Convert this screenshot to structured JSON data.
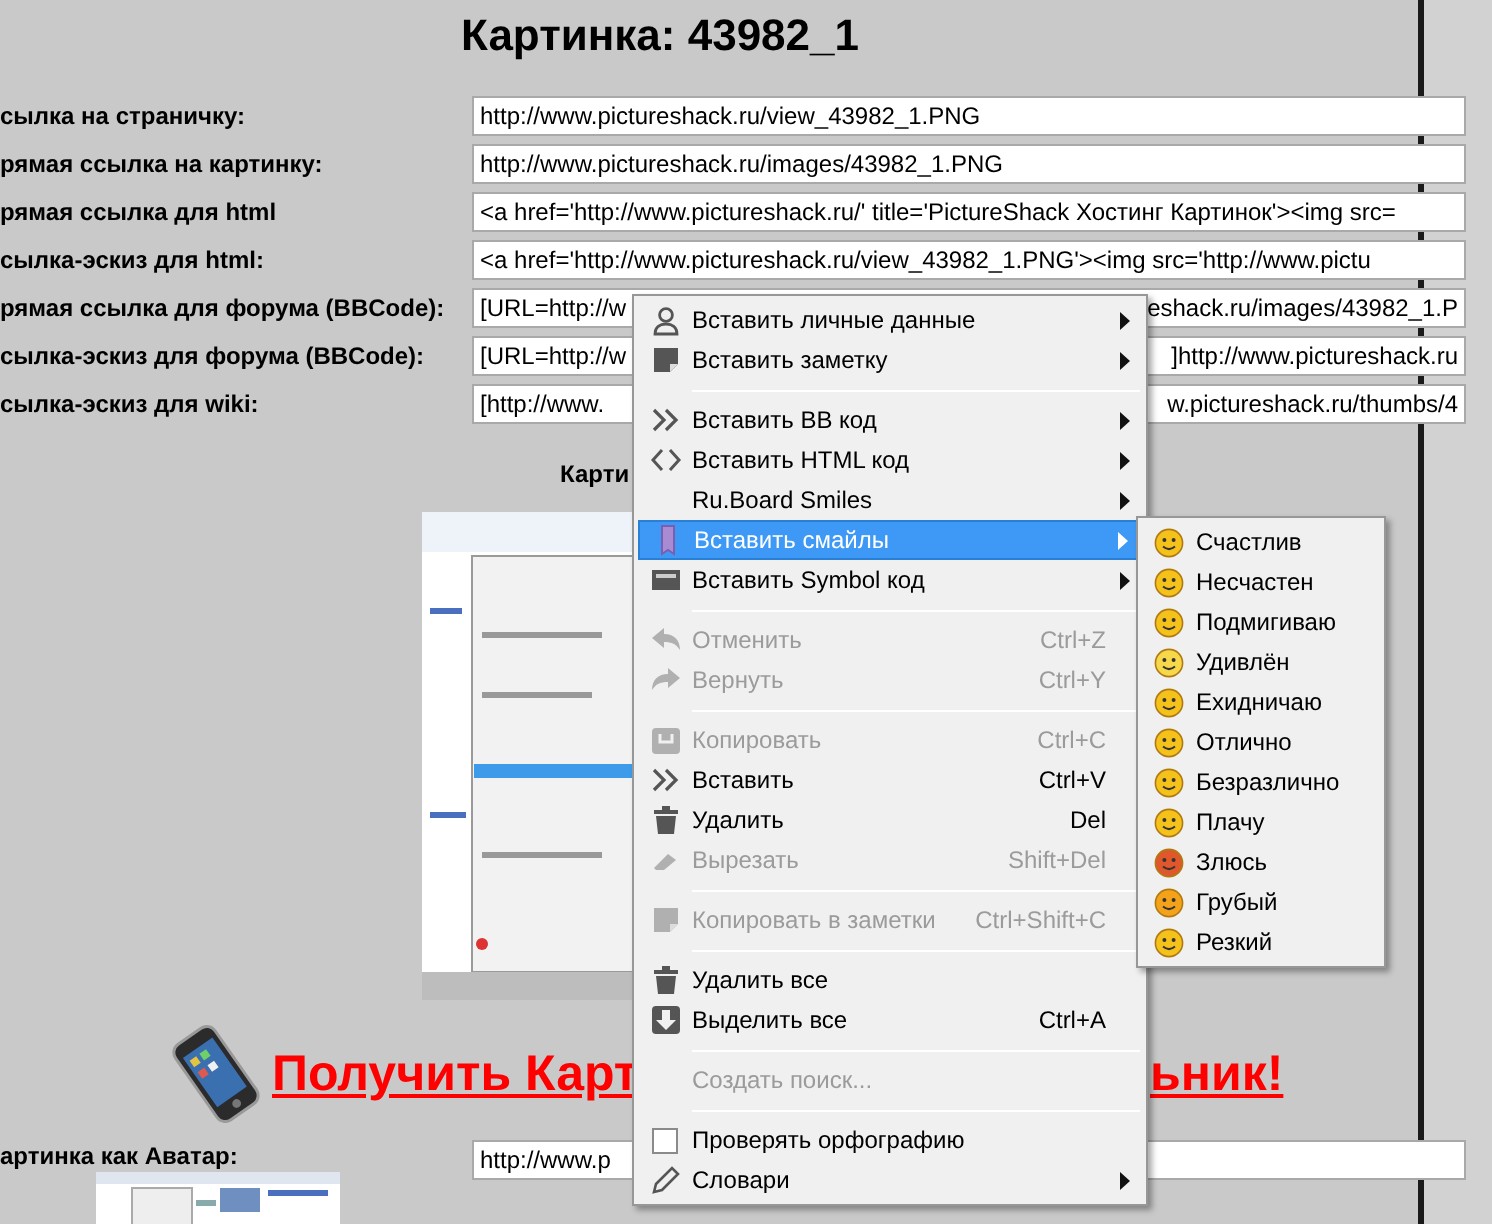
{
  "page_title": "Картинка: 43982_1",
  "link_rows": [
    {
      "label": "сылка на страничку:",
      "value": "http://www.pictureshack.ru/view_43982_1.PNG"
    },
    {
      "label": "рямая ссылка на картинку:",
      "value": "http://www.pictureshack.ru/images/43982_1.PNG"
    },
    {
      "label": "рямая ссылка для html",
      "value": "<a href='http://www.pictureshack.ru/' title='PictureShack Хостинг Картинок'><img src="
    },
    {
      "label": "сылка-эскиз для html:",
      "value": "<a href='http://www.pictureshack.ru/view_43982_1.PNG'><img src='http://www.pictu"
    },
    {
      "label": "рямая ссылка для форума (BBCode):",
      "value_start": "[URL=http://w",
      "value_end": "eshack.ru/images/43982_1.P"
    },
    {
      "label": "сылка-эскиз для форума (BBCode):",
      "value_start": "[URL=http://w",
      "value_end": "]http://www.pictureshack.ru"
    },
    {
      "label": "сылка-эскиз для wiki:",
      "value_start": "[http://www.",
      "value_end": "w.pictureshack.ru/thumbs/4"
    }
  ],
  "preview_heading": "Карти",
  "promo_link": {
    "start": "Получить Карт",
    "end": "ьник!"
  },
  "avatar_row": {
    "label": "артинка как Аватар:",
    "value": "http://www.p"
  },
  "context_menu": {
    "items": [
      {
        "kind": "item",
        "label": "Вставить личные данные",
        "submenu": true,
        "disabled": false,
        "selected": false
      },
      {
        "kind": "item",
        "label": "Вставить заметку",
        "submenu": true,
        "disabled": false,
        "selected": false
      },
      {
        "kind": "separator"
      },
      {
        "kind": "item",
        "label": "Вставить BB код",
        "submenu": true,
        "disabled": false,
        "selected": false
      },
      {
        "kind": "item",
        "label": "Вставить HTML код",
        "submenu": true,
        "disabled": false,
        "selected": false
      },
      {
        "kind": "item",
        "label": "Ru.Board Smiles",
        "submenu": true,
        "disabled": false,
        "selected": false
      },
      {
        "kind": "item",
        "label": "Вставить смайлы",
        "submenu": true,
        "disabled": false,
        "selected": true
      },
      {
        "kind": "item",
        "label": "Вставить Symbol код",
        "submenu": true,
        "disabled": false,
        "selected": false
      },
      {
        "kind": "separator"
      },
      {
        "kind": "item",
        "label": "Отменить",
        "shortcut": "Ctrl+Z",
        "disabled": true,
        "selected": false
      },
      {
        "kind": "item",
        "label": "Вернуть",
        "shortcut": "Ctrl+Y",
        "disabled": true,
        "selected": false
      },
      {
        "kind": "separator"
      },
      {
        "kind": "item",
        "label": "Копировать",
        "shortcut": "Ctrl+C",
        "disabled": true,
        "selected": false
      },
      {
        "kind": "item",
        "label": "Вставить",
        "shortcut": "Ctrl+V",
        "disabled": false,
        "selected": false
      },
      {
        "kind": "item",
        "label": "Удалить",
        "shortcut": "Del",
        "disabled": false,
        "selected": false
      },
      {
        "kind": "item",
        "label": "Вырезать",
        "shortcut": "Shift+Del",
        "disabled": true,
        "selected": false
      },
      {
        "kind": "separator"
      },
      {
        "kind": "item",
        "label": "Копировать в заметки",
        "shortcut": "Ctrl+Shift+C",
        "disabled": true,
        "selected": false
      },
      {
        "kind": "separator"
      },
      {
        "kind": "item",
        "label": "Удалить все",
        "disabled": false,
        "selected": false
      },
      {
        "kind": "item",
        "label": "Выделить все",
        "shortcut": "Ctrl+A",
        "disabled": false,
        "selected": false
      },
      {
        "kind": "separator"
      },
      {
        "kind": "item",
        "label": "Создать поиск...",
        "disabled": true,
        "selected": false
      },
      {
        "kind": "separator"
      },
      {
        "kind": "checkbox",
        "label": "Проверять орфографию",
        "checked": false,
        "disabled": false,
        "selected": false
      },
      {
        "kind": "item",
        "label": "Словари",
        "submenu": true,
        "disabled": false,
        "selected": false
      }
    ]
  },
  "smiley_submenu": {
    "items": [
      {
        "label": "Счастлив",
        "selected": false
      },
      {
        "label": "Несчастен",
        "selected": false
      },
      {
        "label": "Подмигиваю",
        "selected": false
      },
      {
        "label": "Удивлён",
        "selected": false
      },
      {
        "label": "Ехидничаю",
        "selected": false
      },
      {
        "label": "Отлично",
        "selected": false
      },
      {
        "label": "Безразлично",
        "selected": false
      },
      {
        "label": "Плачу",
        "selected": false
      },
      {
        "label": "Злюсь",
        "selected": false
      },
      {
        "label": "Грубый",
        "selected": false
      },
      {
        "label": "Резкий",
        "selected": false
      }
    ]
  }
}
